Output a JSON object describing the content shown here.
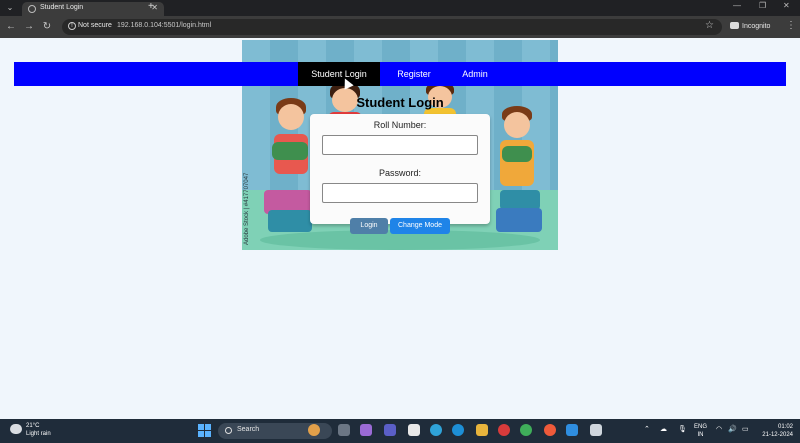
{
  "browser": {
    "tab_title": "Student Login",
    "security_label": "Not secure",
    "url": "192.168.0.104:5501/login.html",
    "profile_label": "Incognito"
  },
  "nav": {
    "items": [
      {
        "label": "Student Login",
        "active": true
      },
      {
        "label": "Register",
        "active": false
      },
      {
        "label": "Admin",
        "active": false
      }
    ],
    "bg_color": "#0000ff",
    "active_color": "#000000"
  },
  "login": {
    "title": "Student Login",
    "roll_label": "Roll Number:",
    "roll_value": "",
    "password_label": "Password:",
    "password_value": "",
    "login_button": "Login",
    "mode_button": "Change Mode"
  },
  "hero": {
    "watermark": "Adobe Stock | #417707047"
  },
  "taskbar": {
    "temperature": "21°C",
    "weather": "Light rain",
    "search_placeholder": "Search",
    "language": "ENG",
    "region": "IN",
    "time": "01:02",
    "date": "21-12-2024"
  }
}
